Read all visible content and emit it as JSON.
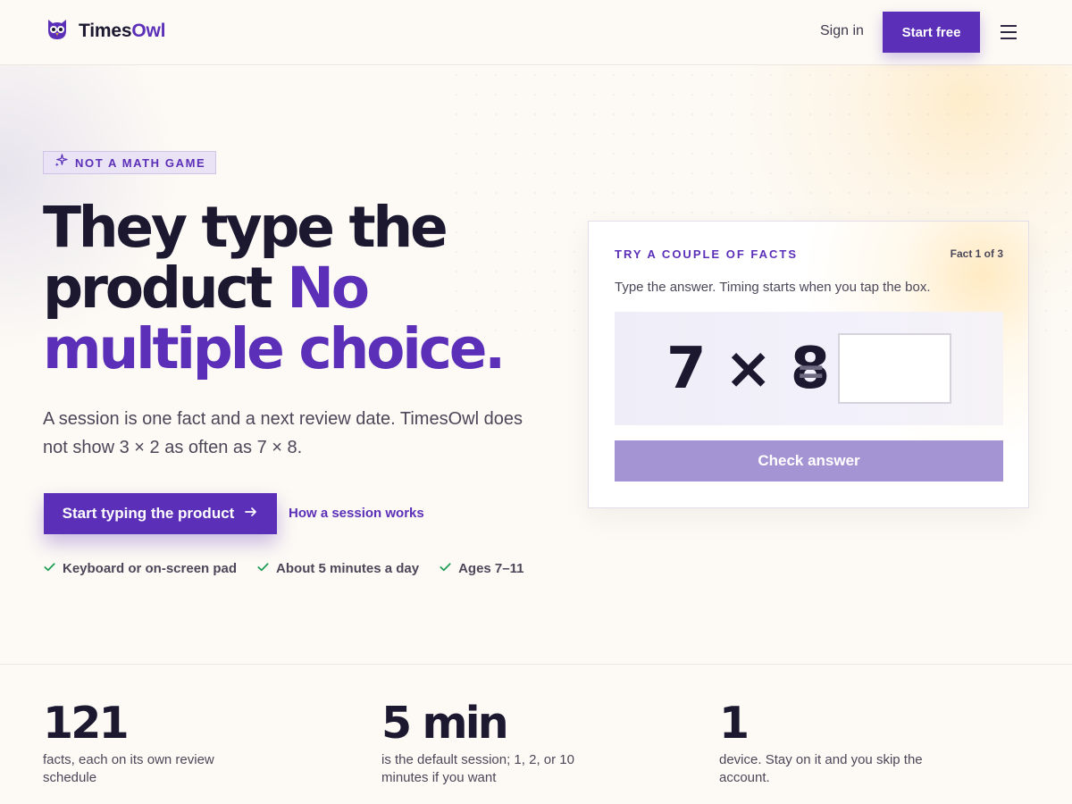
{
  "brand": {
    "name_part1": "Times",
    "name_part2": "Owl",
    "accent_color": "#5b2fb8",
    "logo_icon": "owl-icon"
  },
  "nav": {
    "sign_in": "Sign in",
    "start_free": "Start free",
    "menu_icon": "hamburger-menu-icon"
  },
  "hero": {
    "badge": "NOT A MATH GAME",
    "badge_icon": "sparkle-icon",
    "headline_line1": "They type the",
    "headline_line2_dark": "product ",
    "headline_line2_purple": "No",
    "headline_line3": "multiple choice.",
    "lead": "A session is one fact and a next review date. TimesOwl does not show 3 × 2 as often as 7 × 8.",
    "cta_primary": "Start typing the product",
    "cta_primary_icon": "arrow-right-icon",
    "cta_secondary": "How a session works",
    "checks": [
      "Keyboard or on-screen pad",
      "About 5 minutes a day",
      "Ages 7–11"
    ],
    "check_icon": "checkmark-icon",
    "check_color": "#1f9d55"
  },
  "demo": {
    "eyebrow": "TRY A COUPLE OF FACTS",
    "counter": "Fact 1 of 3",
    "instructions": "Type the answer. Timing starts when you tap the box.",
    "problem": "7 × 8",
    "equals": "=",
    "answer_value": "",
    "check_button": "Check answer",
    "check_button_color": "#a594d4"
  },
  "stats": [
    {
      "value": "121",
      "label": "facts, each on its own review schedule"
    },
    {
      "value": "5 min",
      "label": "is the default session; 1, 2, or 10 minutes if you want"
    },
    {
      "value": "1",
      "label": "device. Stay on it and you skip the account."
    }
  ]
}
